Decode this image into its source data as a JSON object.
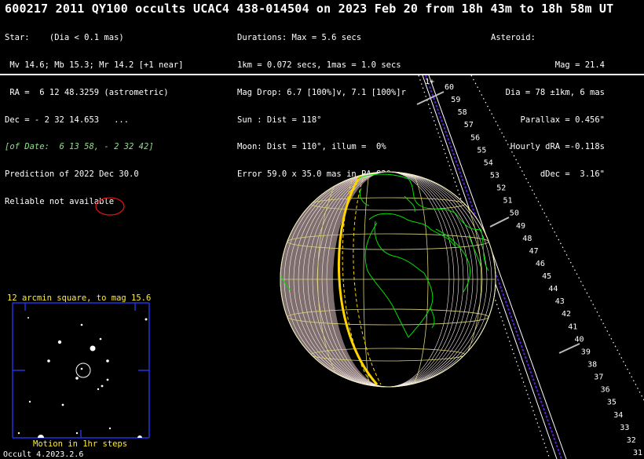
{
  "title": "600217 2011 QY100 occults UCAC4 438-014504 on 2023 Feb 20 from 18h 43m to 18h 58m UT",
  "star_block": [
    "Star:    (Dia < 0.1 mas)",
    " Mv 14.6; Mb 15.3; Mr 14.2 [+1 near]",
    " RA =  6 12 48.3259 (astrometric)",
    "Dec = - 2 32 14.653   ...",
    "[of Date:  6 13 58, - 2 32 42]",
    "Prediction of 2022 Dec 30.0",
    "Reliable not available"
  ],
  "event_block": [
    "Durations: Max = 5.6 secs",
    "1km = 0.072 secs, 1mas = 1.0 secs",
    "Mag Drop: 6.7 [100%]v, 7.1 [100%]r",
    "Sun : Dist = 118°",
    "Moon: Dist = 110°, illum =  0%",
    "Error 59.0 x 35.0 mas in PA 83°"
  ],
  "asteroid_block": [
    "Asteroid:",
    "Mag = 21.4",
    "Dia = 78 ±1km, 6 mas",
    "Parallax = 0.456\"",
    "Hourly dRA =-0.118s",
    "dDec =  3.16\""
  ],
  "star_chart_label": "12 arcmin square, to mag 15.6",
  "motion_label": "Motion in 1hr steps",
  "footer": "Occult 4.2023.2.6",
  "path_start_marker": "1+",
  "minute_ticks": [
    "60",
    "59",
    "58",
    "57",
    "56",
    "55",
    "54",
    "53",
    "52",
    "51",
    "50",
    "49",
    "48",
    "47",
    "46",
    "45",
    "44",
    "43",
    "42",
    "41",
    "40",
    "39",
    "38",
    "37",
    "36",
    "35",
    "34",
    "33",
    "32",
    "31"
  ],
  "colors": {
    "coastline": "#00e000",
    "graticule": "#d8d27a",
    "terminator": "#ffd400",
    "limb_shading": "#ffd8d8",
    "path_center": "#5a1fd0",
    "error_ellipse": "#e01010",
    "star_chart_frame": "#2233dd"
  },
  "map_data": {
    "projection": "orthographic globe",
    "labeled_minutes_count": 30
  }
}
